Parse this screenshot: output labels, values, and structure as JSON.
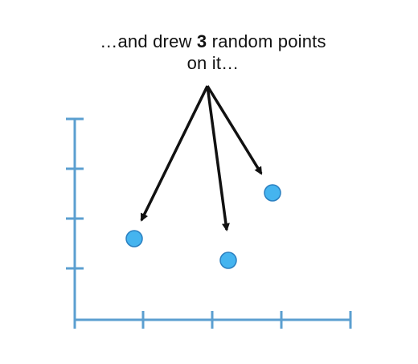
{
  "caption": {
    "line1_before": "…and drew ",
    "line1_bold": "3",
    "line1_after": " random points",
    "line2": "on it…"
  },
  "axes": {
    "x_tick_count": 4,
    "y_tick_count": 4
  },
  "points": {
    "count": 3
  },
  "colors": {
    "axis": "#5b9fd0",
    "point_fill": "#45b4ef",
    "point_stroke": "#2a7fc0",
    "arrow": "#111111",
    "text": "#111111"
  }
}
